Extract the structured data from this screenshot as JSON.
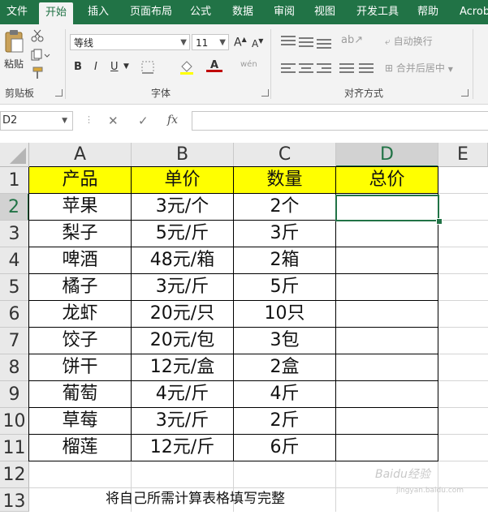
{
  "tabs": [
    {
      "label": "文件"
    },
    {
      "label": "开始"
    },
    {
      "label": "插入"
    },
    {
      "label": "页面布局"
    },
    {
      "label": "公式"
    },
    {
      "label": "数据"
    },
    {
      "label": "审阅"
    },
    {
      "label": "视图"
    },
    {
      "label": "开发工具"
    },
    {
      "label": "帮助"
    },
    {
      "label": "Acroba"
    }
  ],
  "active_tab": "开始",
  "ribbon": {
    "clipboard": {
      "paste_label": "粘贴",
      "group_label": "剪贴板"
    },
    "font": {
      "font_name": "等线",
      "font_size": "11",
      "grow": "A",
      "shrink": "A",
      "bold": "B",
      "italic": "I",
      "underline": "U",
      "font_color": "A",
      "phonetic": "wén",
      "group_label": "字体"
    },
    "alignment": {
      "wrap_text": "自动换行",
      "merge_center": "合并后居中",
      "group_label": "对齐方式"
    }
  },
  "formula_bar": {
    "name_box": "D2",
    "cancel": "✕",
    "enter": "✓",
    "fx": "fx",
    "formula": ""
  },
  "columns": [
    "A",
    "B",
    "C",
    "D",
    "E"
  ],
  "selected_column": "D",
  "rows": [
    "1",
    "2",
    "3",
    "4",
    "5",
    "6",
    "7",
    "8",
    "9",
    "10",
    "11",
    "12",
    "13"
  ],
  "selected_row": "2",
  "table": {
    "headers": [
      "产品",
      "单价",
      "数量",
      "总价"
    ],
    "rows": [
      [
        "苹果",
        "3元/个",
        "2个",
        ""
      ],
      [
        "梨子",
        "5元/斤",
        "3斤",
        ""
      ],
      [
        "啤酒",
        "48元/箱",
        "2箱",
        ""
      ],
      [
        "橘子",
        "3元/斤",
        "5斤",
        ""
      ],
      [
        "龙虾",
        "20元/只",
        "10只",
        ""
      ],
      [
        "饺子",
        "20元/包",
        "3包",
        ""
      ],
      [
        "饼干",
        "12元/盒",
        "2盒",
        ""
      ],
      [
        "葡萄",
        "4元/斤",
        "4斤",
        ""
      ],
      [
        "草莓",
        "3元/斤",
        "2斤",
        ""
      ],
      [
        "榴莲",
        "12元/斤",
        "6斤",
        ""
      ]
    ]
  },
  "caption": "将自己所需计算表格填写完整",
  "watermark": {
    "line1": "Baidu经验",
    "line2": "jingyan.baidu.com"
  },
  "colors": {
    "excel_green": "#217346",
    "header_fill": "#ffff00",
    "ribbon_bg": "#f3f3f3"
  }
}
